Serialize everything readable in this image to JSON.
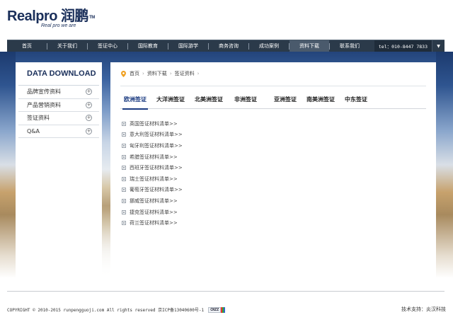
{
  "logo": {
    "brand": "Realpro 润鹏",
    "tm": "TM",
    "tagline": "Real pro we are"
  },
  "nav": {
    "items": [
      {
        "label": "首页",
        "name": "nav-home"
      },
      {
        "label": "关于我们",
        "name": "nav-about"
      },
      {
        "label": "签证中心",
        "name": "nav-visa-center"
      },
      {
        "label": "国际教育",
        "name": "nav-education"
      },
      {
        "label": "国际游学",
        "name": "nav-study-tour"
      },
      {
        "label": "商务咨询",
        "name": "nav-business"
      },
      {
        "label": "成功案例",
        "name": "nav-cases"
      },
      {
        "label": "资料下载",
        "name": "nav-download"
      },
      {
        "label": "联系我们",
        "name": "nav-contact"
      }
    ],
    "active": "资料下载",
    "tel": "tel：010-8447 7833"
  },
  "sidebar": {
    "title": "DATA DOWNLOAD",
    "items": [
      {
        "label": "品牌宣传资料"
      },
      {
        "label": "产品营销资料"
      },
      {
        "label": "签证资料"
      },
      {
        "label": "Q&A"
      }
    ]
  },
  "breadcrumb": {
    "items": [
      "首页",
      "资料下载",
      "签证资料"
    ]
  },
  "tabs": [
    {
      "label": "欧洲签证"
    },
    {
      "label": "大洋洲签证"
    },
    {
      "label": "北美洲签证"
    },
    {
      "label": "非洲签证"
    },
    {
      "label": "亚洲签证"
    },
    {
      "label": "南美洲签证"
    },
    {
      "label": "中东签证"
    }
  ],
  "active_tab": "欧洲签证",
  "documents": [
    "英国签证材料清单>>",
    "意大利签证材料清单>>",
    "匈牙利签证材料清单>>",
    "希腊签证材料清单>>",
    "西班牙签证材料清单>>",
    "瑞士签证材料清单>>",
    "葡萄牙签证材料清单>>",
    "挪威签证材料清单>>",
    "捷克签证材料清单>>",
    "荷兰签证材料清单>>"
  ],
  "footer": {
    "copyright": "COPYRIGHT © 2010-2015 runpengguoji.com All rights reserved 京ICP备13040600号-1",
    "cnzz": "CNZZ",
    "support": "技术支持：炎汉科技"
  },
  "colors": {
    "nav_bg": "#2b3a4a",
    "brand": "#1a2f5a",
    "tab_active": "#1a3a80"
  }
}
